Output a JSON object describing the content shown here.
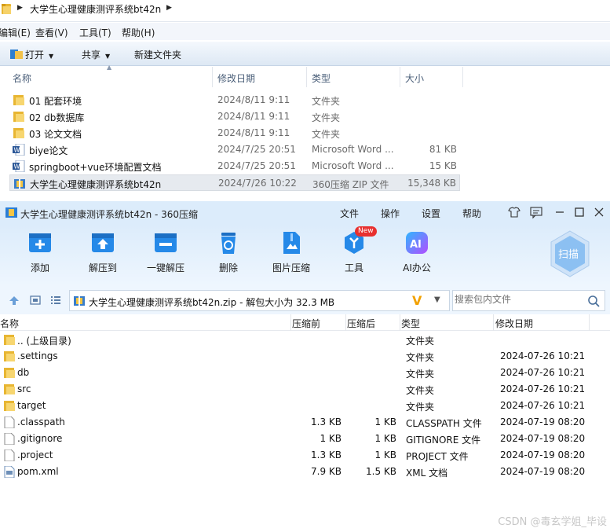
{
  "explorer": {
    "breadcrumb": "大学生心理健康测评系统bt42n",
    "menu": [
      "编辑(E)",
      "查看(V)",
      "工具(T)",
      "帮助(H)"
    ],
    "toolbar": {
      "open": "打开",
      "share": "共享",
      "new_folder": "新建文件夹"
    },
    "columns": {
      "name": "名称",
      "date": "修改日期",
      "type": "类型",
      "size": "大小"
    },
    "files": [
      {
        "icon": "folder-icon",
        "name": "01 配套环境",
        "date": "2024/8/11 9:11",
        "type": "文件夹",
        "size": ""
      },
      {
        "icon": "folder-icon",
        "name": "02 db数据库",
        "date": "2024/8/11 9:11",
        "type": "文件夹",
        "size": ""
      },
      {
        "icon": "folder-icon",
        "name": "03 论文文档",
        "date": "2024/8/11 9:11",
        "type": "文件夹",
        "size": ""
      },
      {
        "icon": "word-doc-icon",
        "name": "biye论文",
        "date": "2024/7/25 20:51",
        "type": "Microsoft Word ...",
        "size": "81 KB"
      },
      {
        "icon": "word-doc-icon",
        "name": "springboot+vue环境配置文档",
        "date": "2024/7/25 20:51",
        "type": "Microsoft Word ...",
        "size": "15 KB"
      },
      {
        "icon": "zip-archive-icon",
        "name": "大学生心理健康测评系统bt42n",
        "date": "2024/7/26 10:22",
        "type": "360压缩 ZIP 文件",
        "size": "15,348 KB",
        "selected": true
      }
    ]
  },
  "zip": {
    "title": "大学生心理健康测评系统bt42n - 360压缩",
    "menu": [
      "文件",
      "操作",
      "设置",
      "帮助"
    ],
    "tools": [
      {
        "icon": "add-icon",
        "label": "添加"
      },
      {
        "icon": "extract-to-icon",
        "label": "解压到"
      },
      {
        "icon": "one-click-extract-icon",
        "label": "一键解压"
      },
      {
        "icon": "delete-icon",
        "label": "删除"
      },
      {
        "icon": "image-compress-icon",
        "label": "图片压缩"
      },
      {
        "icon": "tools-icon",
        "label": "工具"
      },
      {
        "icon": "ai-office-icon",
        "label": "AI办公"
      }
    ],
    "new_badge": "New",
    "scan_label": "扫描",
    "path": "大学生心理健康测评系统bt42n.zip - 解包大小为 32.3 MB",
    "search_placeholder": "搜索包内文件",
    "columns": {
      "name": "名称",
      "before": "压缩前",
      "after": "压缩后",
      "type": "类型",
      "date": "修改日期"
    },
    "entries": [
      {
        "icon": "folder-icon",
        "name": ".. (上级目录)",
        "before": "",
        "after": "",
        "type": "文件夹",
        "date": ""
      },
      {
        "icon": "folder-icon",
        "name": ".settings",
        "before": "",
        "after": "",
        "type": "文件夹",
        "date": "2024-07-26 10:21"
      },
      {
        "icon": "folder-icon",
        "name": "db",
        "before": "",
        "after": "",
        "type": "文件夹",
        "date": "2024-07-26 10:21"
      },
      {
        "icon": "folder-icon",
        "name": "src",
        "before": "",
        "after": "",
        "type": "文件夹",
        "date": "2024-07-26 10:21"
      },
      {
        "icon": "folder-icon",
        "name": "target",
        "before": "",
        "after": "",
        "type": "文件夹",
        "date": "2024-07-26 10:21"
      },
      {
        "icon": "file-icon",
        "name": ".classpath",
        "before": "1.3 KB",
        "after": "1 KB",
        "type": "CLASSPATH 文件",
        "date": "2024-07-19 08:20"
      },
      {
        "icon": "file-icon",
        "name": ".gitignore",
        "before": "1 KB",
        "after": "1 KB",
        "type": "GITIGNORE 文件",
        "date": "2024-07-19 08:20"
      },
      {
        "icon": "file-icon",
        "name": ".project",
        "before": "1.3 KB",
        "after": "1 KB",
        "type": "PROJECT 文件",
        "date": "2024-07-19 08:20"
      },
      {
        "icon": "xml-file-icon",
        "name": "pom.xml",
        "before": "7.9 KB",
        "after": "1.5 KB",
        "type": "XML 文档",
        "date": "2024-07-19 08:20"
      }
    ]
  },
  "watermark": "CSDN @毒玄学姐_毕设"
}
